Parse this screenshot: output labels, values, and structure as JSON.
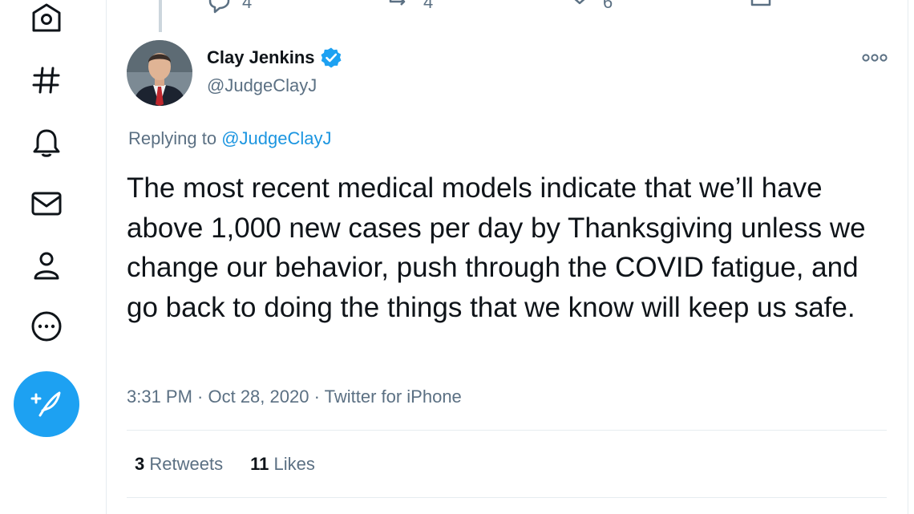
{
  "nav": {
    "icons": [
      "home-icon",
      "explore-hash-icon",
      "notifications-bell-icon",
      "messages-envelope-icon",
      "profile-person-icon",
      "more-circle-icon"
    ],
    "compose_icon": "compose-feather-icon",
    "accent": "#1da1f2"
  },
  "previous_tweet": {
    "reply_count": "4",
    "retweet_count": "4",
    "like_count": "6"
  },
  "tweet": {
    "display_name": "Clay Jenkins",
    "handle": "@JudgeClayJ",
    "verified": true,
    "replying_prefix": "Replying to",
    "replying_to": "@JudgeClayJ",
    "text": "The most recent medical models indicate that we’ll have above 1,000 new cases per day by Thanksgiving unless we change our behavior, push through the COVID fatigue, and go back to doing the things that we know will keep us safe.",
    "meta": "3:31 PM · Oct 28, 2020 · Twitter for iPhone",
    "retweets_count": "3",
    "retweets_label": "Retweets",
    "likes_count": "11",
    "likes_label": "Likes"
  },
  "colors": {
    "text_primary": "#0f1419",
    "text_secondary": "#5b7083",
    "link": "#1b95e0",
    "border": "#e6ecf0"
  }
}
